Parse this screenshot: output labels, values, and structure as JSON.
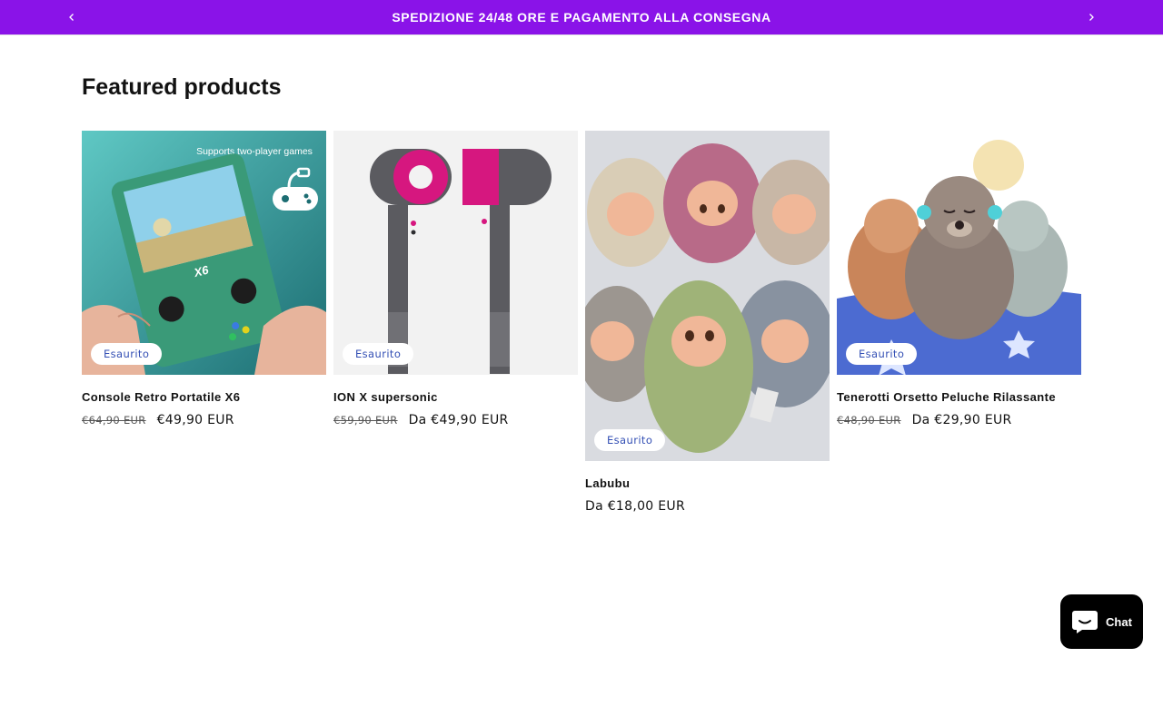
{
  "announcement": {
    "text": "SPEDIZIONE 24/48 ORE E PAGAMENTO ALLA CONSEGNA",
    "background": "#8a13e8",
    "prev_icon": "chevron-left-icon",
    "next_icon": "chevron-right-icon"
  },
  "section": {
    "title": "Featured products"
  },
  "products": [
    {
      "image_caption": "Supports two-player games",
      "image_label": "X6",
      "badge": "Esaurito",
      "title": "Console Retro Portatile X6",
      "compare_price": "€64,90 EUR",
      "price": "€49,90 EUR"
    },
    {
      "badge": "Esaurito",
      "title": "ION X supersonic",
      "compare_price": "€59,90 EUR",
      "price": "Da €49,90 EUR"
    },
    {
      "badge": "Esaurito",
      "title": "Labubu",
      "price": "Da €18,00 EUR"
    },
    {
      "badge": "Esaurito",
      "title": "Tenerotti Orsetto Peluche Rilassante",
      "compare_price": "€48,90 EUR",
      "price": "Da €29,90 EUR"
    }
  ],
  "chat": {
    "label": "Chat",
    "icon": "chat-bubble-icon"
  },
  "colors": {
    "badge_text": "#334fb4",
    "text": "#121212",
    "chat_bg": "#000000"
  }
}
